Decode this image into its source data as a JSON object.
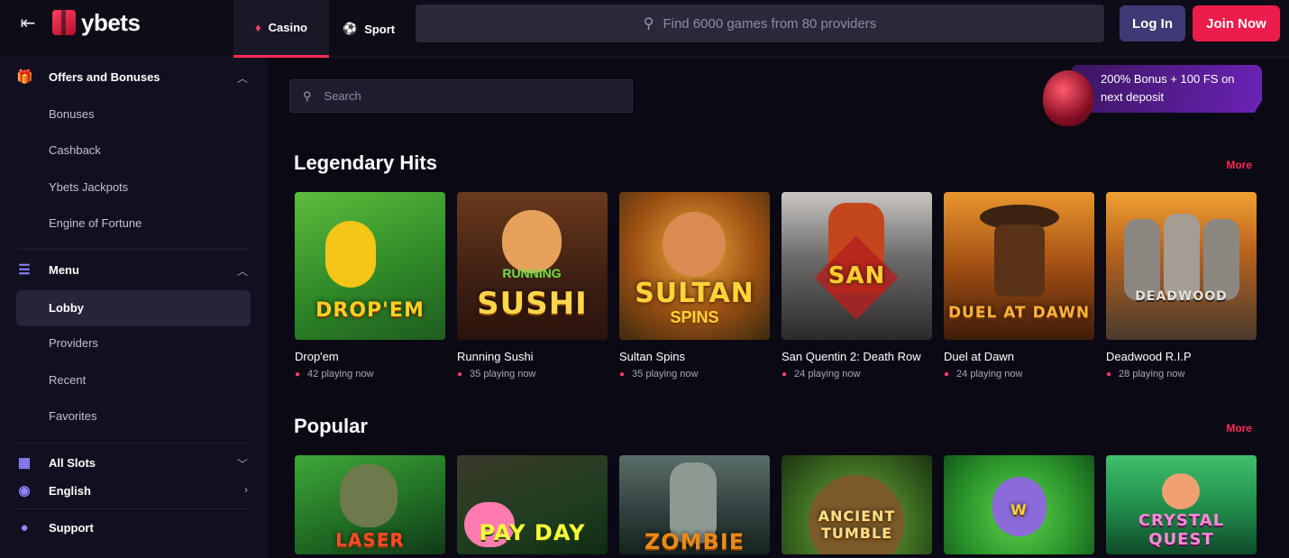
{
  "header": {
    "brand": "ybets",
    "tabs": [
      {
        "label": "Casino",
        "icon": "casino-cards-icon",
        "active": true
      },
      {
        "label": "Sport",
        "icon": "soccer-ball-icon",
        "active": false
      }
    ],
    "search_placeholder": "Find 6000 games from 80 providers",
    "login_label": "Log In",
    "join_label": "Join Now",
    "accent_color": "#ec1d4b"
  },
  "sidebar": {
    "offers": {
      "title": "Offers and Bonuses",
      "items": [
        "Bonuses",
        "Cashback",
        "Ybets Jackpots",
        "Engine of Fortune"
      ]
    },
    "menu": {
      "title": "Menu",
      "items": [
        "Lobby",
        "Providers",
        "Recent",
        "Favorites"
      ],
      "active": "Lobby"
    },
    "all_slots": "All Slots",
    "language": "English",
    "support": "Support"
  },
  "main": {
    "search_placeholder": "Search",
    "promo": "200% Bonus + 100 FS on next deposit",
    "more_label": "More",
    "legendary": {
      "title": "Legendary Hits",
      "games": [
        {
          "name": "Drop'em",
          "art": "DROP'EM",
          "playing": "42 playing now"
        },
        {
          "name": "Running Sushi",
          "art": "SUSHI",
          "playing": "35 playing now"
        },
        {
          "name": "Sultan Spins",
          "art": "SULTAN",
          "playing": "35 playing now"
        },
        {
          "name": "San Quentin 2: Death Row",
          "art": "SAN",
          "playing": "24 playing now"
        },
        {
          "name": "Duel at Dawn",
          "art": "DUEL AT DAWN",
          "playing": "24 playing now"
        },
        {
          "name": "Deadwood R.I.P",
          "art": "DEADWOOD",
          "playing": "28 playing now"
        }
      ]
    },
    "popular": {
      "title": "Popular",
      "games": [
        {
          "art": "LASER"
        },
        {
          "art": "PAY DAY"
        },
        {
          "art": "ZOMBIE"
        },
        {
          "art": "ANCIENT TUMBLE"
        },
        {
          "art": "W"
        },
        {
          "art": "CRYSTAL QUEST"
        }
      ]
    }
  }
}
